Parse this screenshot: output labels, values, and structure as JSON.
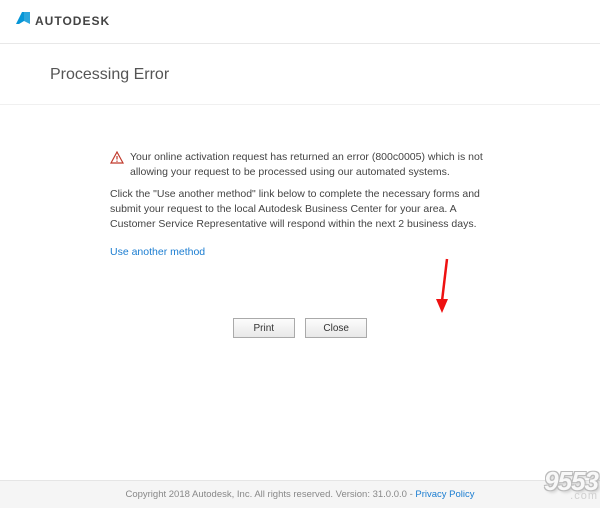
{
  "header": {
    "brand": "AUTODESK"
  },
  "title": "Processing Error",
  "error_message": "Your online activation request has returned an error (800c0005) which is not allowing your request to be processed using our automated systems.",
  "instruction": "Click the \"Use another method\" link below to complete the necessary forms and submit your request to the local Autodesk Business Center for your area. A Customer Service Representative will respond within the next 2 business days.",
  "link_text": "Use another method",
  "buttons": {
    "print": "Print",
    "close": "Close"
  },
  "footer": {
    "copyright": "Copyright 2018 Autodesk, Inc. All rights reserved. Version: 31.0.0.0 - ",
    "privacy": "Privacy Policy"
  },
  "watermark": {
    "top": "9553",
    "bottom": ".com"
  }
}
